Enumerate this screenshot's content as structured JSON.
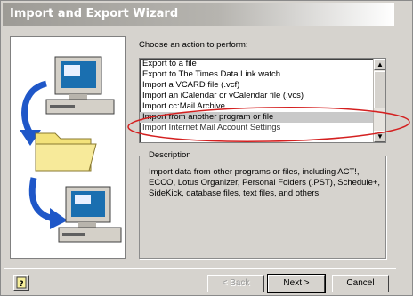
{
  "window": {
    "title": "Import and Export Wizard"
  },
  "prompt": "Choose an action to perform:",
  "actions": {
    "items": [
      {
        "label": "Export to a file",
        "selected": false
      },
      {
        "label": "Export to The Times Data Link watch",
        "selected": false
      },
      {
        "label": "Import a VCARD file (.vcf)",
        "selected": false
      },
      {
        "label": "Import an iCalendar or vCalendar file (.vcs)",
        "selected": false
      },
      {
        "label": "Import cc:Mail Archive",
        "selected": false
      },
      {
        "label": "Import from another program or file",
        "selected": true
      },
      {
        "label": "Import Internet Mail Account Settings",
        "selected": false
      }
    ]
  },
  "description": {
    "legend": "Description",
    "text": "Import data from other programs or files, including ACT!, ECCO, Lotus Organizer, Personal Folders (.PST), Schedule+, SideKick, database files, text files, and others."
  },
  "buttons": {
    "back": "< Back",
    "next": "Next >",
    "cancel": "Cancel"
  },
  "icons": {
    "help": "help-icon",
    "computer": "computer-icon",
    "folder": "folder-icon",
    "arrow": "curved-arrow-icon"
  },
  "colors": {
    "arrow": "#1f57c8",
    "folder": "#f3e27a",
    "annotation": "#d42020"
  }
}
